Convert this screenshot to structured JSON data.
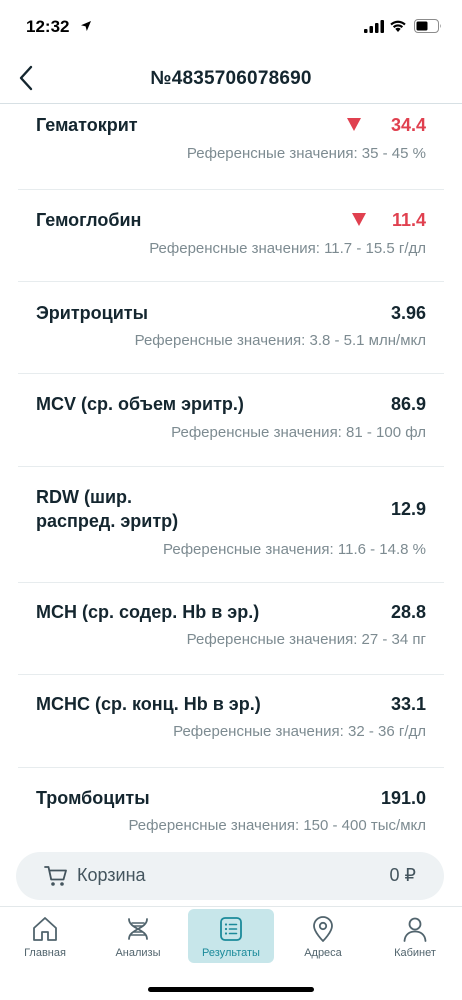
{
  "status_bar": {
    "time": "12:32",
    "icons": [
      "location-arrow-icon",
      "signal-icon",
      "wifi-icon",
      "battery-icon"
    ]
  },
  "header": {
    "title": "№4835706078690",
    "back_icon": "chevron-left-icon"
  },
  "results": [
    {
      "name": "Гематокрит",
      "value": "34.4",
      "flag": "low",
      "reference": "Референсные значения: 35 - 45 %"
    },
    {
      "name": "Гемоглобин",
      "value": "11.4",
      "flag": "low",
      "reference": "Референсные значения: 11.7 - 15.5 г/дл"
    },
    {
      "name": "Эритроциты",
      "value": "3.96",
      "flag": "normal",
      "reference": "Референсные значения: 3.8 - 5.1 млн/мкл"
    },
    {
      "name": "MCV (ср. объем эритр.)",
      "value": "86.9",
      "flag": "normal",
      "reference": "Референсные значения: 81 - 100 фл"
    },
    {
      "name_line1": "RDW (шир.",
      "name_line2": "распред. эритр)",
      "value": "12.9",
      "flag": "normal",
      "reference": "Референсные значения: 11.6 - 14.8 %"
    },
    {
      "name": "MCH (ср. содер. Hb в эр.)",
      "value": "28.8",
      "flag": "normal",
      "reference": "Референсные значения: 27 - 34 пг"
    },
    {
      "name": "MCHC (ср. конц. Hb в эр.)",
      "value": "33.1",
      "flag": "normal",
      "reference": "Референсные значения: 32 - 36 г/дл"
    },
    {
      "name": "Тромбоциты",
      "value": "191.0",
      "flag": "normal",
      "reference": "Референсные значения: 150 - 400 тыс/мкл"
    }
  ],
  "cart": {
    "label": "Корзина",
    "amount": "0 ₽",
    "icon": "cart-icon"
  },
  "tabs": [
    {
      "label": "Главная",
      "icon": "home-icon",
      "active": false
    },
    {
      "label": "Анализы",
      "icon": "dna-icon",
      "active": false
    },
    {
      "label": "Результаты",
      "icon": "list-icon",
      "active": true
    },
    {
      "label": "Адреса",
      "icon": "map-pin-icon",
      "active": false
    },
    {
      "label": "Кабинет",
      "icon": "user-icon",
      "active": false
    }
  ],
  "colors": {
    "accent": "#1b8a9a",
    "active_tab_bg": "#c7e6ea",
    "low_value": "#e0404f",
    "text_primary": "#14262f",
    "text_secondary": "#7d8b91"
  }
}
